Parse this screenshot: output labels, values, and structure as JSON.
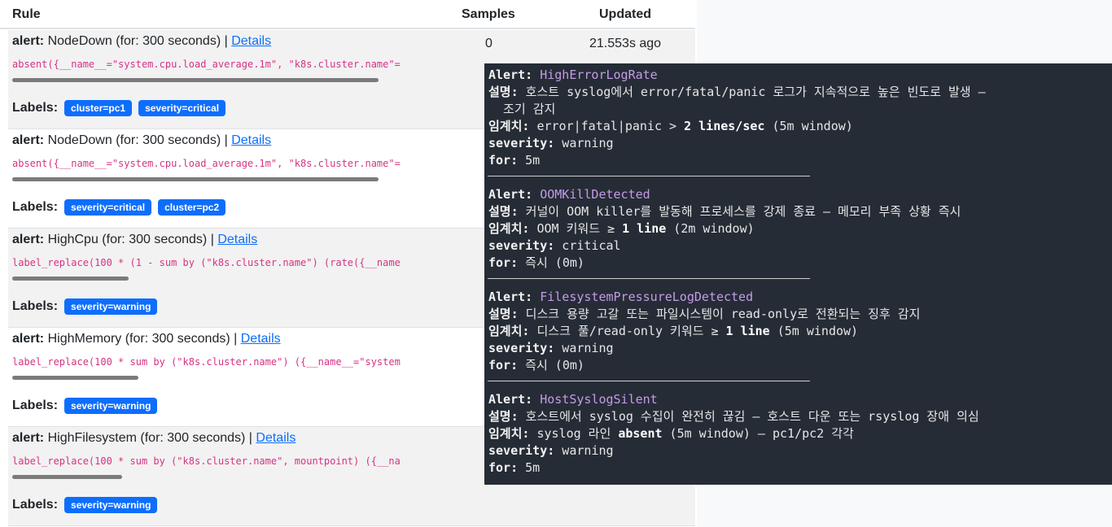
{
  "table": {
    "headers": {
      "rule": "Rule",
      "samples": "Samples",
      "updated": "Updated"
    },
    "first_row": {
      "samples": "0",
      "updated": "21.553s ago"
    },
    "alert_prefix": "alert:",
    "labels_prefix": "Labels:",
    "details_label": "Details",
    "rows": [
      {
        "name": "NodeDown",
        "for": "(for: 300 seconds) |",
        "expr": "absent({__name__=\"system.cpu.load_average.1m\", \"k8s.cluster.name\"=",
        "labels": [
          "cluster=pc1",
          "severity=critical"
        ]
      },
      {
        "name": "NodeDown",
        "for": "(for: 300 seconds) |",
        "expr": "absent({__name__=\"system.cpu.load_average.1m\", \"k8s.cluster.name\"=",
        "labels": [
          "severity=critical",
          "cluster=pc2"
        ]
      },
      {
        "name": "HighCpu",
        "for": "(for: 300 seconds) |",
        "expr": "label_replace(100 * (1 - sum by (\"k8s.cluster.name\") (rate({__name",
        "labels": [
          "severity=warning"
        ]
      },
      {
        "name": "HighMemory",
        "for": "(for: 300 seconds) |",
        "expr": "label_replace(100 * sum by (\"k8s.cluster.name\") ({__name__=\"system",
        "labels": [
          "severity=warning"
        ]
      },
      {
        "name": "HighFilesystem",
        "for": "(for: 300 seconds) |",
        "expr": "label_replace(100 * sum by (\"k8s.cluster.name\", mountpoint) ({__na",
        "labels": [
          "severity=warning"
        ]
      }
    ]
  },
  "terminal": {
    "blocks": [
      {
        "alert_key": "Alert:",
        "alert_name": "HighErrorLogRate",
        "desc_key": "설명:",
        "desc": " 호스트 syslog에서 error/fatal/panic 로그가 지속적으로 높은 빈도로 발생 –",
        "desc_cont": "  조기 감지",
        "thr_key": "임계치:",
        "thr_pre": " error|fatal|panic > ",
        "thr_strong": "2 lines/sec",
        "thr_post": " (5m window)",
        "sev_key": "severity:",
        "sev": " warning",
        "for_key": "for:",
        "for": " 5m"
      },
      {
        "alert_key": "Alert:",
        "alert_name": "OOMKillDetected",
        "desc_key": "설명:",
        "desc": " 커널이 OOM killer를 발동해 프로세스를 강제 종료 – 메모리 부족 상황 즉시",
        "thr_key": "임계치:",
        "thr_pre": " OOM 키워드 ≥ ",
        "thr_strong": "1 line",
        "thr_post": " (2m window)",
        "sev_key": "severity:",
        "sev": " critical",
        "for_key": "for:",
        "for": " 즉시 (0m)"
      },
      {
        "alert_key": "Alert:",
        "alert_name": "FilesystemPressureLogDetected",
        "desc_key": "설명:",
        "desc": " 디스크 용량 고갈 또는 파일시스템이 read-only로 전환되는 징후 감지",
        "thr_key": "임계치:",
        "thr_pre": " 디스크 풀/read-only 키워드 ≥ ",
        "thr_strong": "1 line",
        "thr_post": " (5m window)",
        "sev_key": "severity:",
        "sev": " warning",
        "for_key": "for:",
        "for": " 즉시 (0m)"
      },
      {
        "alert_key": "Alert:",
        "alert_name": "HostSyslogSilent",
        "desc_key": "설명:",
        "desc": " 호스트에서 syslog 수집이 완전히 끊김 – 호스트 다운 또는 rsyslog 장애 의심",
        "thr_key": "임계치:",
        "thr_pre": " syslog 라인 ",
        "thr_strong": "absent",
        "thr_post": " (5m window) – pc1/pc2 각각",
        "sev_key": "severity:",
        "sev": " warning",
        "for_key": "for:",
        "for": " 5m"
      }
    ]
  }
}
